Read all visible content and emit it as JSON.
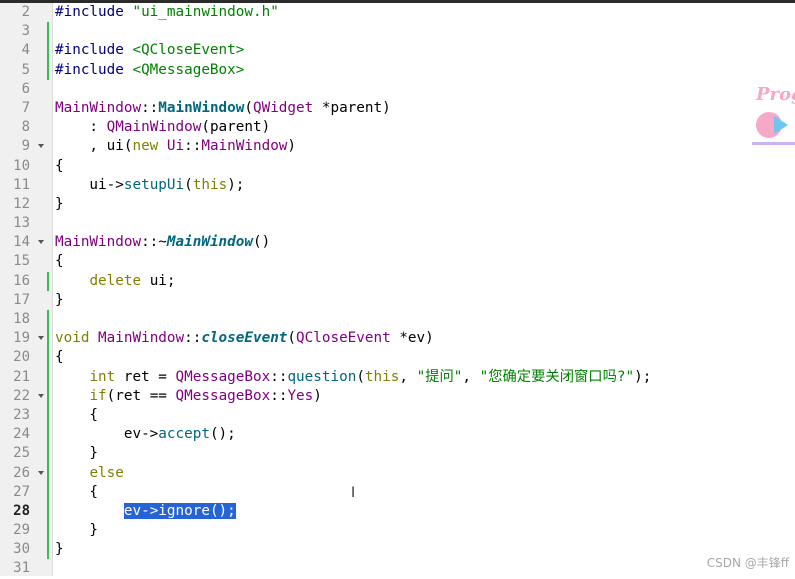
{
  "editor": {
    "current_line": 28,
    "lines": [
      {
        "n": "2",
        "fold": false,
        "mark": false,
        "segs": [
          {
            "t": "#include ",
            "c": "t-pre"
          },
          {
            "t": "\"ui_mainwindow.h\"",
            "c": "t-str"
          }
        ]
      },
      {
        "n": "3",
        "fold": false,
        "mark": true,
        "segs": []
      },
      {
        "n": "4",
        "fold": false,
        "mark": true,
        "segs": [
          {
            "t": "#include ",
            "c": "t-pre"
          },
          {
            "t": "<QCloseEvent>",
            "c": "t-str"
          }
        ]
      },
      {
        "n": "5",
        "fold": false,
        "mark": true,
        "segs": [
          {
            "t": "#include ",
            "c": "t-pre"
          },
          {
            "t": "<QMessageBox>",
            "c": "t-str"
          }
        ]
      },
      {
        "n": "6",
        "fold": false,
        "mark": false,
        "segs": []
      },
      {
        "n": "7",
        "fold": false,
        "mark": false,
        "segs": [
          {
            "t": "MainWindow",
            "c": "t-type"
          },
          {
            "t": "::",
            "c": ""
          },
          {
            "t": "MainWindow",
            "c": "t-bold"
          },
          {
            "t": "(",
            "c": ""
          },
          {
            "t": "QWidget",
            "c": "t-type"
          },
          {
            "t": " *parent)",
            "c": ""
          }
        ]
      },
      {
        "n": "8",
        "fold": false,
        "mark": false,
        "segs": [
          {
            "t": "    : ",
            "c": ""
          },
          {
            "t": "QMainWindow",
            "c": "t-type"
          },
          {
            "t": "(parent)",
            "c": ""
          }
        ]
      },
      {
        "n": "9",
        "fold": true,
        "mark": false,
        "segs": [
          {
            "t": "    , ui(",
            "c": ""
          },
          {
            "t": "new",
            "c": "t-kw"
          },
          {
            "t": " ",
            "c": ""
          },
          {
            "t": "Ui",
            "c": "t-type"
          },
          {
            "t": "::",
            "c": ""
          },
          {
            "t": "MainWindow",
            "c": "t-type"
          },
          {
            "t": ")",
            "c": ""
          }
        ]
      },
      {
        "n": "10",
        "fold": false,
        "mark": false,
        "segs": [
          {
            "t": "{",
            "c": ""
          }
        ]
      },
      {
        "n": "11",
        "fold": false,
        "mark": false,
        "segs": [
          {
            "t": "    ui->",
            "c": ""
          },
          {
            "t": "setupUi",
            "c": "t-fn"
          },
          {
            "t": "(",
            "c": ""
          },
          {
            "t": "this",
            "c": "t-kw"
          },
          {
            "t": ");",
            "c": ""
          }
        ]
      },
      {
        "n": "12",
        "fold": false,
        "mark": false,
        "segs": [
          {
            "t": "}",
            "c": ""
          }
        ]
      },
      {
        "n": "13",
        "fold": false,
        "mark": false,
        "segs": []
      },
      {
        "n": "14",
        "fold": true,
        "mark": false,
        "segs": [
          {
            "t": "MainWindow",
            "c": "t-type"
          },
          {
            "t": "::~",
            "c": ""
          },
          {
            "t": "MainWindow",
            "c": "t-ital"
          },
          {
            "t": "()",
            "c": ""
          }
        ]
      },
      {
        "n": "15",
        "fold": false,
        "mark": false,
        "segs": [
          {
            "t": "{",
            "c": ""
          }
        ]
      },
      {
        "n": "16",
        "fold": false,
        "mark": true,
        "segs": [
          {
            "t": "    ",
            "c": ""
          },
          {
            "t": "delete",
            "c": "t-kw"
          },
          {
            "t": " ui;",
            "c": ""
          }
        ]
      },
      {
        "n": "17",
        "fold": false,
        "mark": false,
        "segs": [
          {
            "t": "}",
            "c": ""
          }
        ]
      },
      {
        "n": "18",
        "fold": false,
        "mark": true,
        "segs": []
      },
      {
        "n": "19",
        "fold": true,
        "mark": true,
        "segs": [
          {
            "t": "void",
            "c": "t-kw"
          },
          {
            "t": " ",
            "c": ""
          },
          {
            "t": "MainWindow",
            "c": "t-type"
          },
          {
            "t": "::",
            "c": ""
          },
          {
            "t": "closeEvent",
            "c": "t-ital"
          },
          {
            "t": "(",
            "c": ""
          },
          {
            "t": "QCloseEvent",
            "c": "t-type"
          },
          {
            "t": " *ev)",
            "c": ""
          }
        ]
      },
      {
        "n": "20",
        "fold": false,
        "mark": true,
        "segs": [
          {
            "t": "{",
            "c": ""
          }
        ]
      },
      {
        "n": "21",
        "fold": false,
        "mark": true,
        "segs": [
          {
            "t": "    ",
            "c": ""
          },
          {
            "t": "int",
            "c": "t-kw"
          },
          {
            "t": " ret = ",
            "c": ""
          },
          {
            "t": "QMessageBox",
            "c": "t-type"
          },
          {
            "t": "::",
            "c": ""
          },
          {
            "t": "question",
            "c": "t-fn"
          },
          {
            "t": "(",
            "c": ""
          },
          {
            "t": "this",
            "c": "t-kw"
          },
          {
            "t": ", ",
            "c": ""
          },
          {
            "t": "\"提问\"",
            "c": "t-str"
          },
          {
            "t": ", ",
            "c": ""
          },
          {
            "t": "\"您确定要关闭窗口吗?\"",
            "c": "t-str"
          },
          {
            "t": ");",
            "c": ""
          }
        ]
      },
      {
        "n": "22",
        "fold": true,
        "mark": true,
        "segs": [
          {
            "t": "    ",
            "c": ""
          },
          {
            "t": "if",
            "c": "t-kw"
          },
          {
            "t": "(ret == ",
            "c": ""
          },
          {
            "t": "QMessageBox",
            "c": "t-type"
          },
          {
            "t": "::",
            "c": ""
          },
          {
            "t": "Yes",
            "c": "t-type"
          },
          {
            "t": ")",
            "c": ""
          }
        ]
      },
      {
        "n": "23",
        "fold": false,
        "mark": true,
        "segs": [
          {
            "t": "    {",
            "c": ""
          }
        ]
      },
      {
        "n": "24",
        "fold": false,
        "mark": true,
        "segs": [
          {
            "t": "        ev->",
            "c": ""
          },
          {
            "t": "accept",
            "c": "t-fn"
          },
          {
            "t": "();",
            "c": ""
          }
        ]
      },
      {
        "n": "25",
        "fold": false,
        "mark": true,
        "segs": [
          {
            "t": "    }",
            "c": ""
          }
        ]
      },
      {
        "n": "26",
        "fold": true,
        "mark": true,
        "segs": [
          {
            "t": "    ",
            "c": ""
          },
          {
            "t": "else",
            "c": "t-kw"
          }
        ]
      },
      {
        "n": "27",
        "fold": false,
        "mark": true,
        "segs": [
          {
            "t": "    {",
            "c": ""
          }
        ]
      },
      {
        "n": "28",
        "fold": false,
        "mark": true,
        "segs": [
          {
            "t": "        ",
            "c": ""
          },
          {
            "t": "ev->ignore();",
            "c": "t-sel"
          }
        ]
      },
      {
        "n": "29",
        "fold": false,
        "mark": true,
        "segs": [
          {
            "t": "    }",
            "c": ""
          }
        ]
      },
      {
        "n": "30",
        "fold": false,
        "mark": true,
        "segs": [
          {
            "t": "}",
            "c": ""
          }
        ]
      },
      {
        "n": "31",
        "fold": false,
        "mark": false,
        "segs": []
      }
    ]
  },
  "logo": {
    "text": "Prog"
  },
  "watermark": {
    "text": "CSDN @丰锋ff"
  }
}
